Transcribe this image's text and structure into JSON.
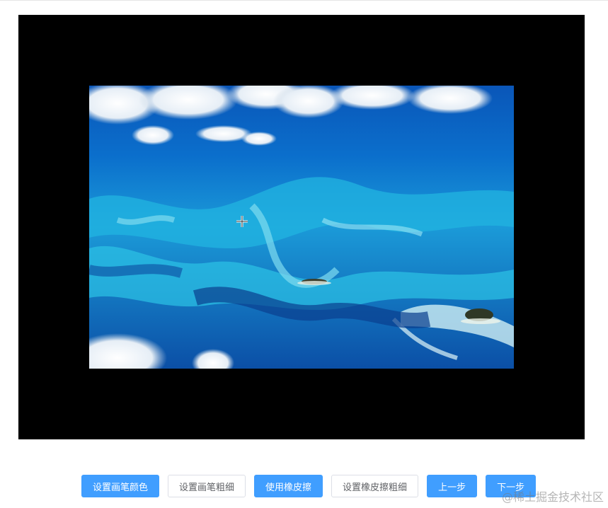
{
  "toolbar": {
    "buttons": [
      {
        "label": "设置画笔颜色",
        "style": "primary"
      },
      {
        "label": "设置画笔粗细",
        "style": "plain"
      },
      {
        "label": "使用橡皮擦",
        "style": "primary"
      },
      {
        "label": "设置橡皮擦粗细",
        "style": "plain"
      },
      {
        "label": "上一步",
        "style": "primary"
      },
      {
        "label": "下一步",
        "style": "primary"
      }
    ]
  },
  "watermark": "@稀土掘金技术社区",
  "colors": {
    "primary": "#409eff",
    "canvas_bg": "#000000",
    "plain_border": "#dcdfe6",
    "plain_text": "#606266"
  },
  "icons": {
    "cursor": "crosshair-cursor-icon"
  }
}
